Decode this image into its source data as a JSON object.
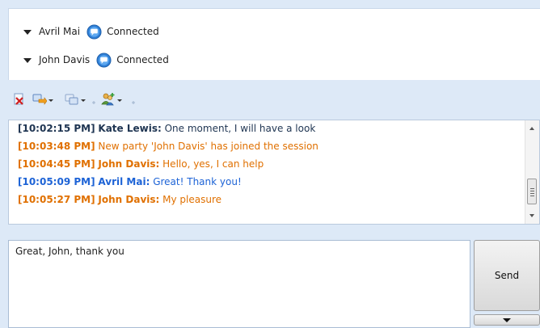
{
  "participants": [
    {
      "name": "Avril Mai",
      "status": "Connected"
    },
    {
      "name": "John Davis",
      "status": "Connected"
    }
  ],
  "toolbar": {
    "buttons": [
      {
        "icon": "end-session-icon"
      },
      {
        "icon": "transfer-icon"
      },
      {
        "icon": "conference-icon"
      },
      {
        "icon": "add-party-icon"
      }
    ]
  },
  "transcript": {
    "messages": [
      {
        "time": "[10:02:15 PM]",
        "sender": "Kate Lewis:",
        "text": "One moment, I will have a look",
        "color": "#1f3552"
      },
      {
        "time": "[10:03:48 PM]",
        "sender": "",
        "text": "New party 'John Davis' has joined the session",
        "color": "#e07000"
      },
      {
        "time": "[10:04:45 PM]",
        "sender": "John Davis:",
        "text": "Hello, yes, I can help",
        "color": "#e07000"
      },
      {
        "time": "[10:05:09 PM]",
        "sender": "Avril Mai:",
        "text": "Great! Thank you!",
        "color": "#1d63d6"
      },
      {
        "time": "[10:05:27 PM]",
        "sender": "John Davis:",
        "text": "My pleasure",
        "color": "#e07000"
      }
    ]
  },
  "composer": {
    "value": "Great, John, thank you",
    "send_label": "Send"
  },
  "colors": {
    "accent_orange": "#e07000",
    "accent_blue": "#1d63d6",
    "status_icon": "#2f7fd6"
  }
}
